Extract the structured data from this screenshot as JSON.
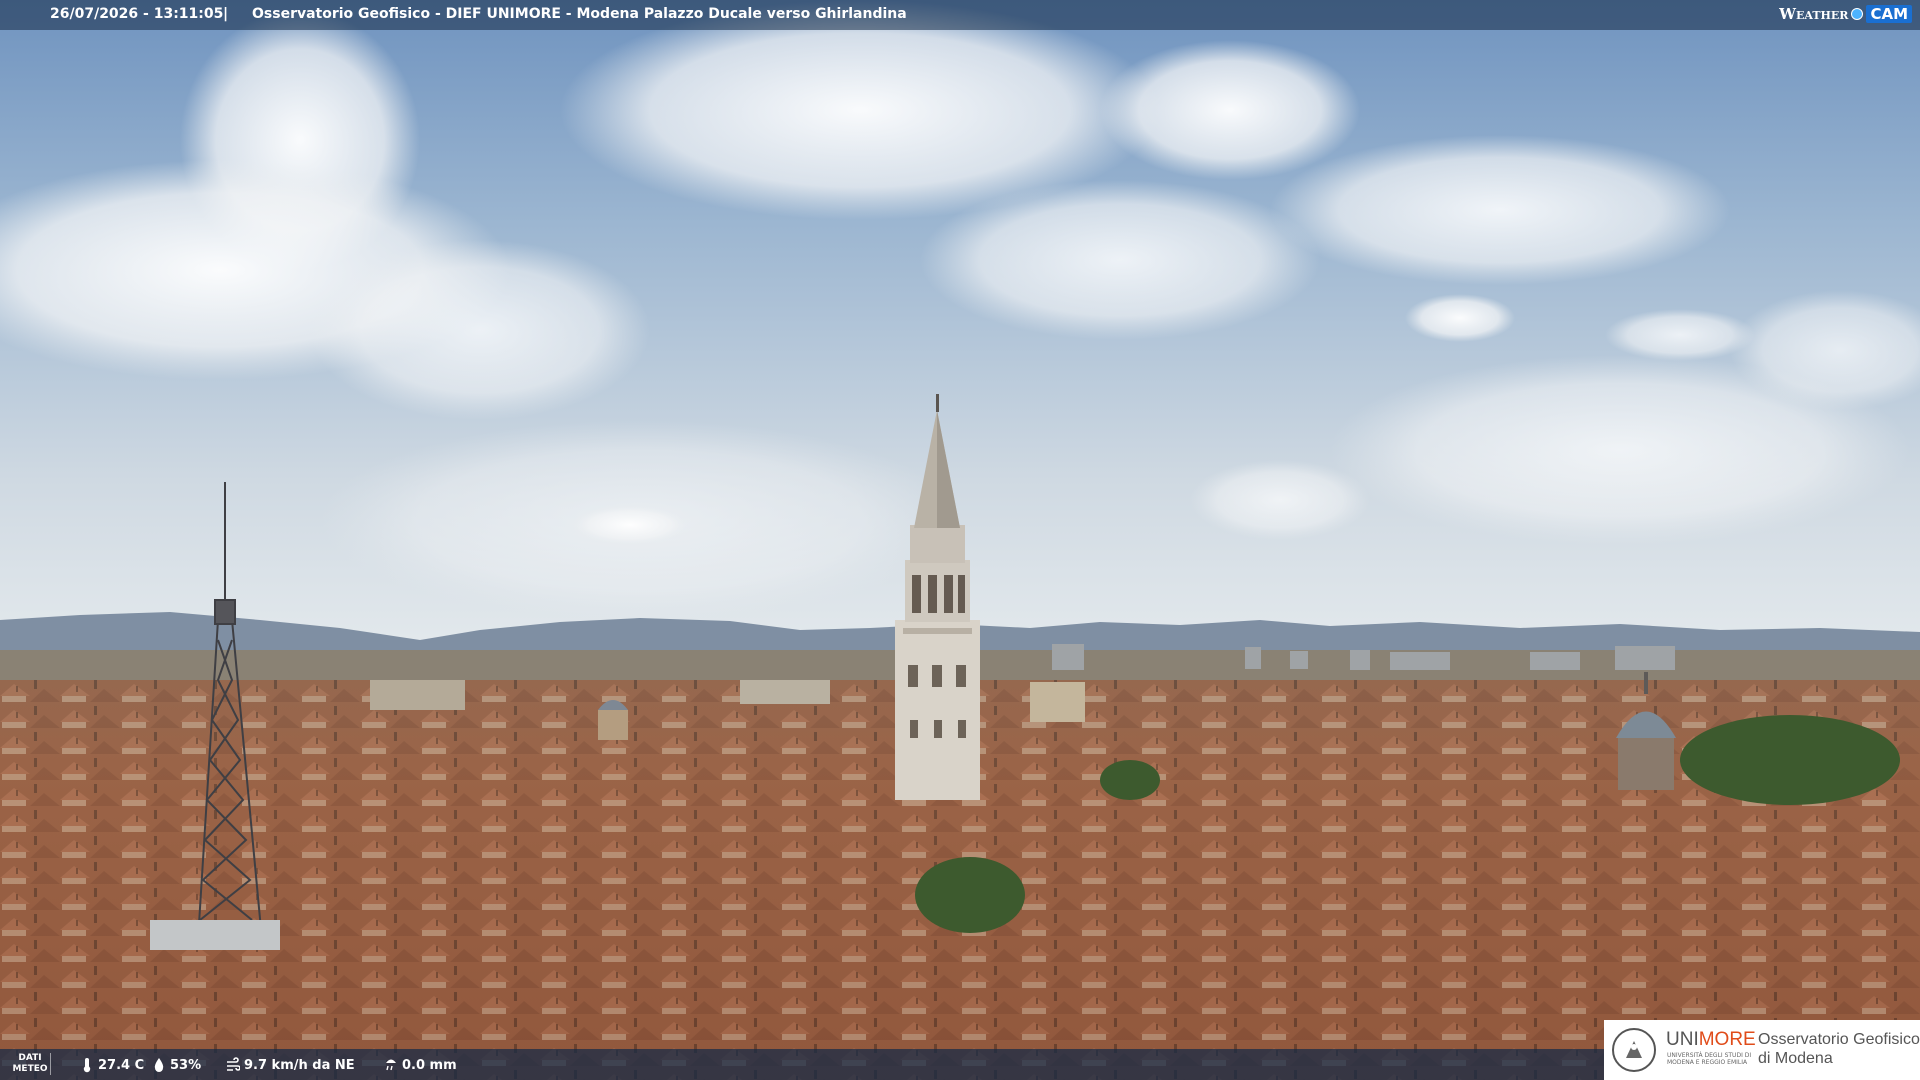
{
  "overlay": {
    "timestamp": "26/07/2026 - 13:11:05",
    "separator": "|",
    "title": "Osservatorio Geofisico - DIEF UNIMORE - Modena Palazzo Ducale verso Ghirlandina",
    "brand_weather": "Weather",
    "brand_cam": "CAM"
  },
  "meteo": {
    "label": "DATI METEO",
    "temperature": "27.4 C",
    "humidity": "53%",
    "wind": "9.7 km/h da NE",
    "rain": "0.0 mm"
  },
  "logo": {
    "uni_part1": "UNI",
    "uni_part2": "MORE",
    "uni_subtitle": "UNIVERSITÀ DEGLI STUDI DI MODENA E REGGIO EMILIA",
    "observatory": "Osservatorio Geofisico\ndi Modena"
  },
  "colors": {
    "sky_top": "#6f93bf",
    "sky_horizon": "#dfe5ea",
    "roof": "#a5684a",
    "tower": "#d6d0c6",
    "unimore_orange": "#e04c1a"
  },
  "icons": [
    "thermometer-icon",
    "humidity-drop-icon",
    "wind-icon",
    "rain-gauge-icon",
    "unimore-seal-icon"
  ]
}
